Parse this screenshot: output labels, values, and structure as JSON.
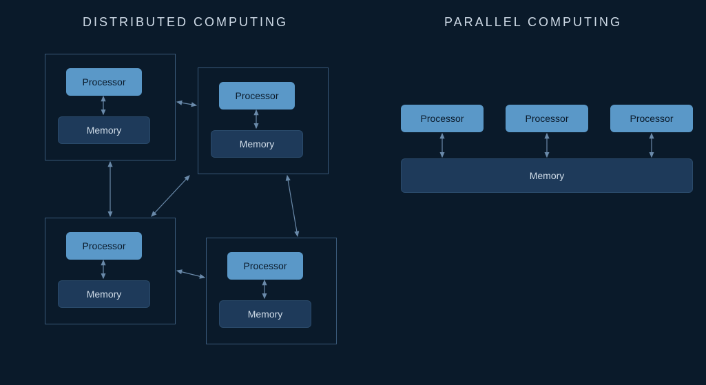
{
  "titles": {
    "left": "DISTRIBUTED COMPUTING",
    "right": "PARALLEL COMPUTING"
  },
  "labels": {
    "processor": "Processor",
    "memory": "Memory"
  },
  "distributed": {
    "nodes": [
      {
        "id": "node-1",
        "processor_label": "Processor",
        "memory_label": "Memory"
      },
      {
        "id": "node-2",
        "processor_label": "Processor",
        "memory_label": "Memory"
      },
      {
        "id": "node-3",
        "processor_label": "Processor",
        "memory_label": "Memory"
      },
      {
        "id": "node-4",
        "processor_label": "Processor",
        "memory_label": "Memory"
      }
    ]
  },
  "parallel": {
    "processors": [
      {
        "label": "Processor"
      },
      {
        "label": "Processor"
      },
      {
        "label": "Processor"
      }
    ],
    "memory_label": "Memory"
  },
  "colors": {
    "background": "#0a1a2a",
    "processor_fill": "#5a98c8",
    "memory_fill": "#1e3a5a",
    "border": "#3a5a7a",
    "arrow": "#6a8aaa",
    "text_light": "#d0dce8"
  }
}
